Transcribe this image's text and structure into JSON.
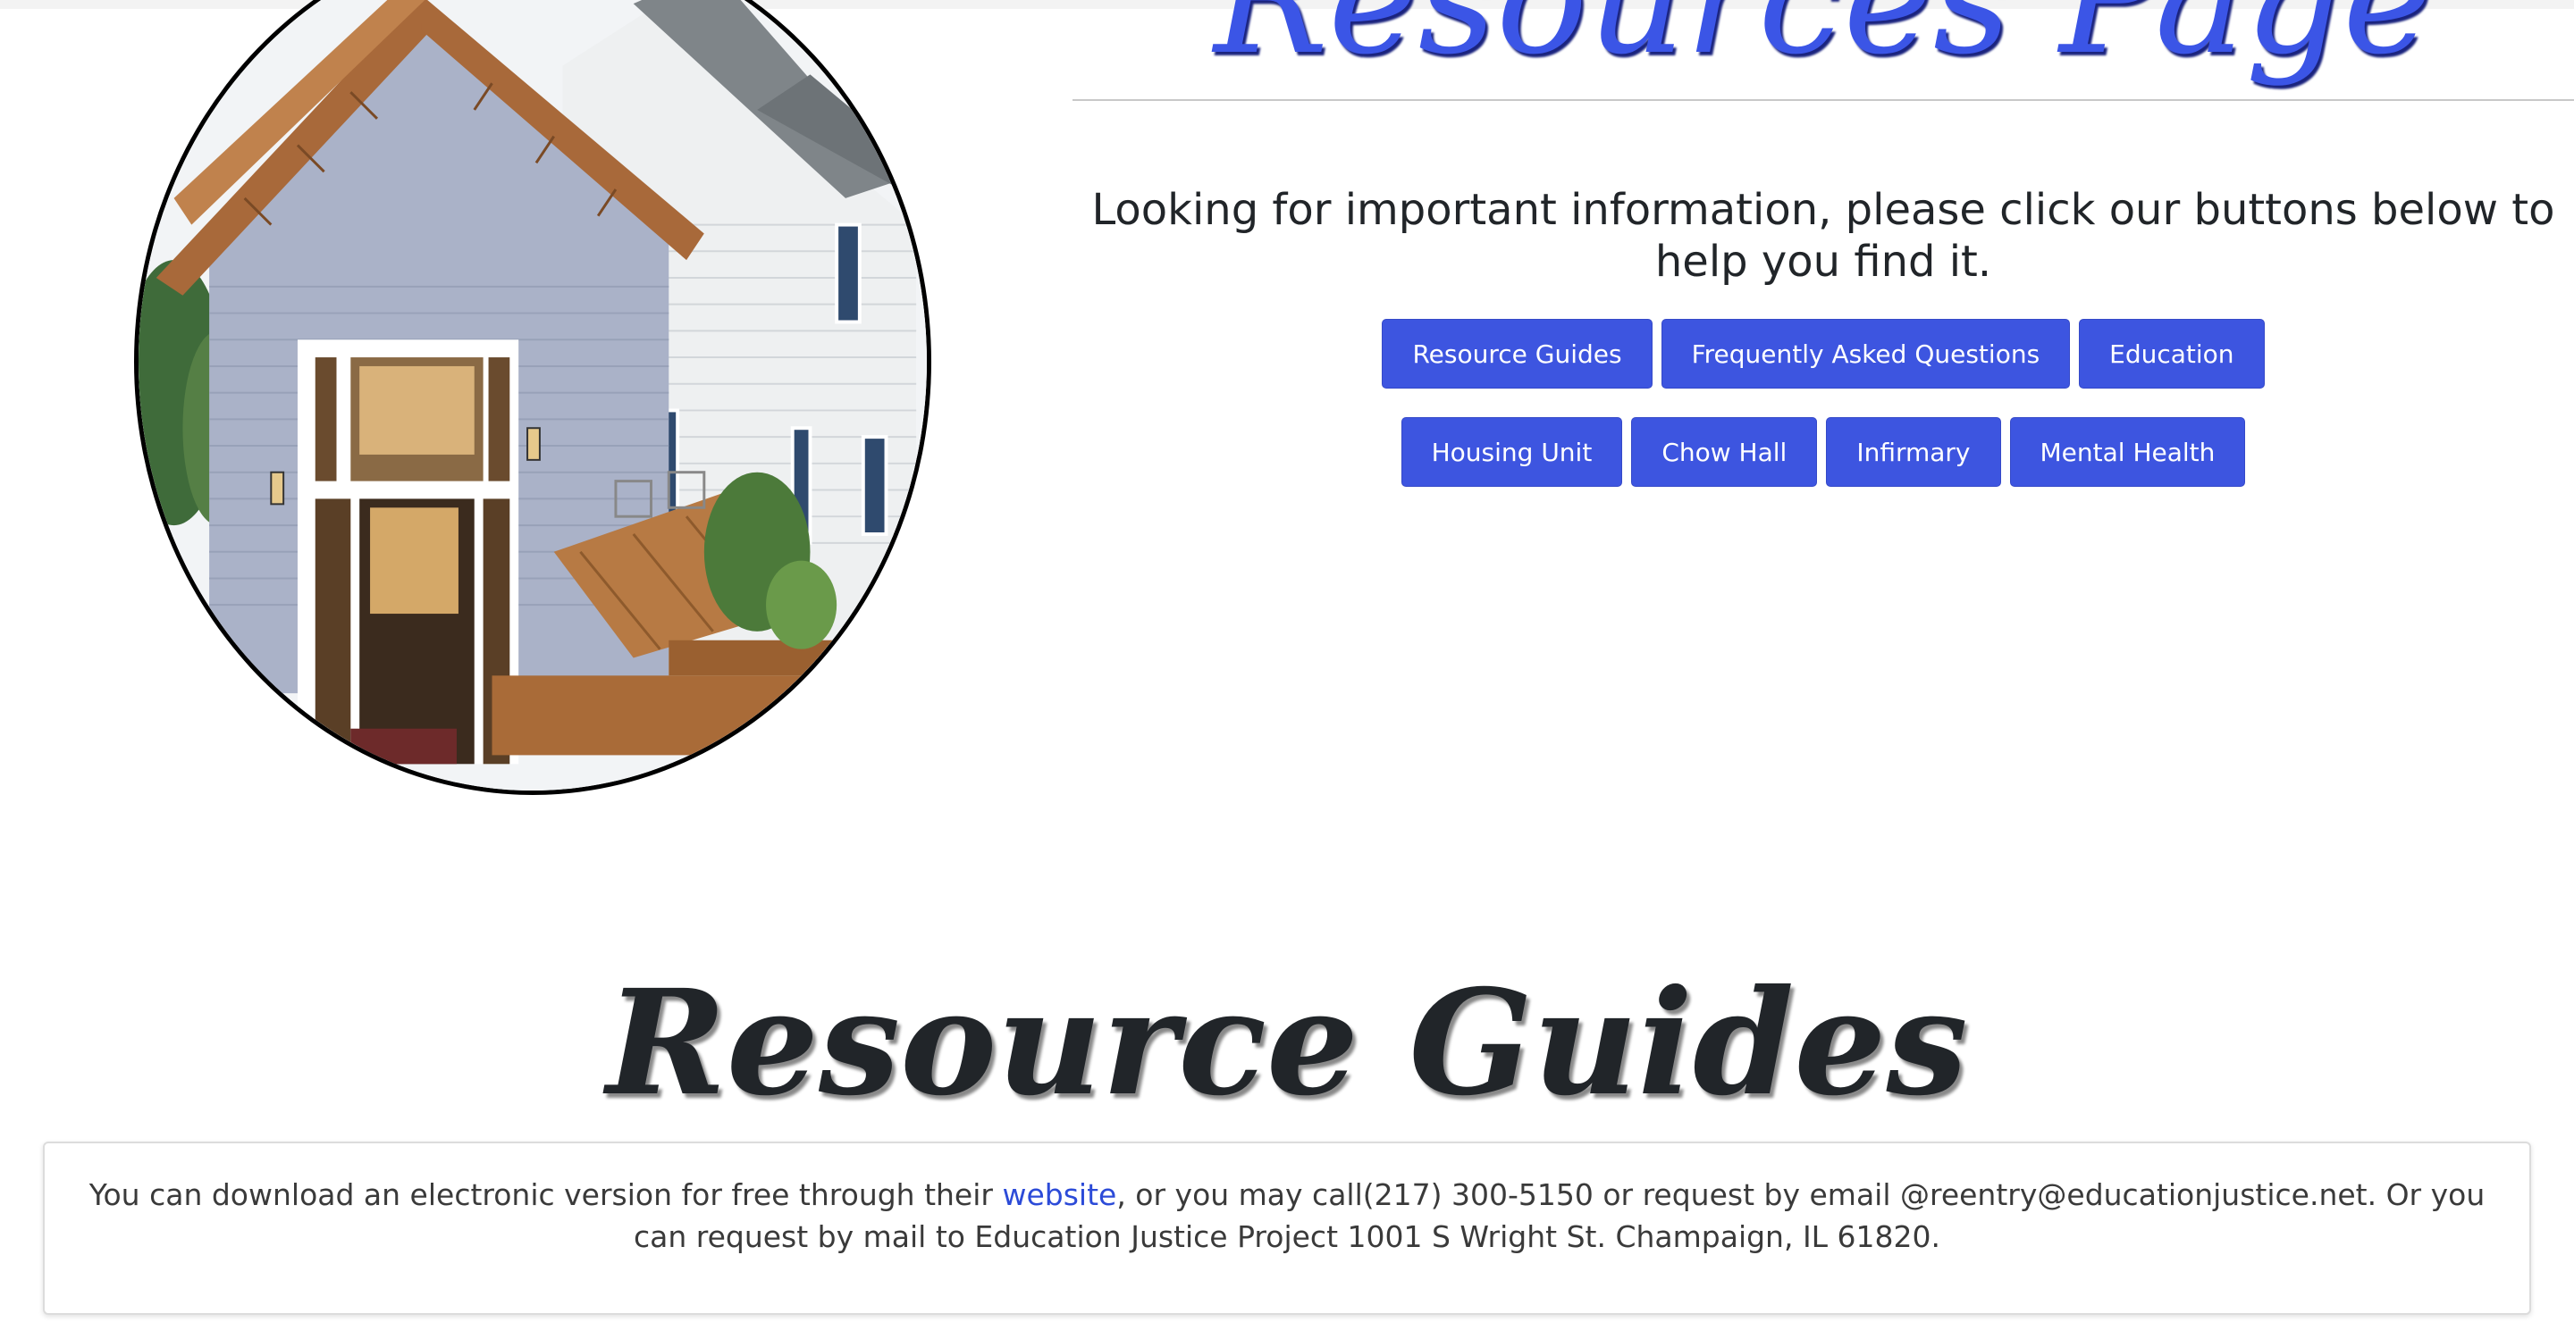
{
  "header": {
    "page_title": "Resources Page"
  },
  "hero": {
    "image_name": "house photo"
  },
  "intro": {
    "text": "Looking for important information, please click our buttons below to help you find it."
  },
  "buttons": {
    "row1": [
      "Resource Guides",
      "Frequently Asked Questions",
      "Education"
    ],
    "row2": [
      "Housing Unit",
      "Chow Hall",
      "Infirmary",
      "Mental Health"
    ]
  },
  "resource_guides": {
    "title": "Resource Guides",
    "text_before_link": "You can download an electronic version for free through their ",
    "link_text": "website",
    "text_after_link": ", or you may call(217) 300-5150 or request by email @reentry@educationjustice.net. Or you can request by mail to Education Justice Project 1001 S Wright St. Champaign, IL 61820."
  },
  "colors": {
    "button_bg": "#3d55e0",
    "title_blue": "#3b55e6",
    "link": "#2c4bd8"
  }
}
